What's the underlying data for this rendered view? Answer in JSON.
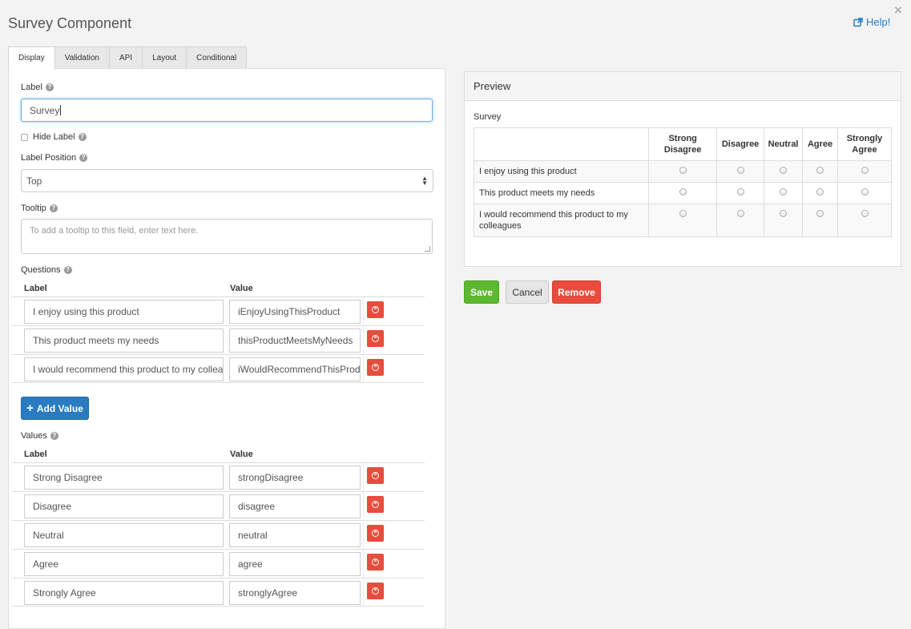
{
  "window": {
    "title": "Survey Component",
    "help_label": "Help!",
    "close_glyph": "×"
  },
  "tabs": [
    {
      "label": "Display",
      "active": true
    },
    {
      "label": "Validation",
      "active": false
    },
    {
      "label": "API",
      "active": false
    },
    {
      "label": "Layout",
      "active": false
    },
    {
      "label": "Conditional",
      "active": false
    }
  ],
  "form": {
    "label_field": {
      "label": "Label",
      "value": "Survey"
    },
    "hide_label": {
      "label": "Hide Label",
      "checked": false
    },
    "label_position": {
      "label": "Label Position",
      "value": "Top"
    },
    "tooltip": {
      "label": "Tooltip",
      "placeholder": "To add a tooltip to this field, enter text here."
    },
    "questions": {
      "label": "Questions",
      "col_label": "Label",
      "col_value": "Value",
      "rows": [
        {
          "label": "I enjoy using this product",
          "value": "iEnjoyUsingThisProduct"
        },
        {
          "label": "This product meets my needs",
          "value": "thisProductMeetsMyNeeds"
        },
        {
          "label": "I would recommend this product to my colleag",
          "value": "iWouldRecommendThisProd"
        }
      ],
      "add_label": "Add Value"
    },
    "values": {
      "label": "Values",
      "col_label": "Label",
      "col_value": "Value",
      "rows": [
        {
          "label": "Strong Disagree",
          "value": "strongDisagree"
        },
        {
          "label": "Disagree",
          "value": "disagree"
        },
        {
          "label": "Neutral",
          "value": "neutral"
        },
        {
          "label": "Agree",
          "value": "agree"
        },
        {
          "label": "Strongly Agree",
          "value": "stronglyAgree"
        }
      ]
    }
  },
  "preview": {
    "heading": "Preview",
    "survey_label": "Survey",
    "columns": [
      "Strong Disagree",
      "Disagree",
      "Neutral",
      "Agree",
      "Strongly Agree"
    ],
    "questions": [
      "I enjoy using this product",
      "This product meets my needs",
      "I would recommend this product to my colleagues"
    ]
  },
  "actions": {
    "save": "Save",
    "cancel": "Cancel",
    "remove": "Remove"
  },
  "colors": {
    "accent_blue": "#2a7bc0",
    "save_green": "#5cb82f",
    "danger_red": "#e74c3c"
  }
}
